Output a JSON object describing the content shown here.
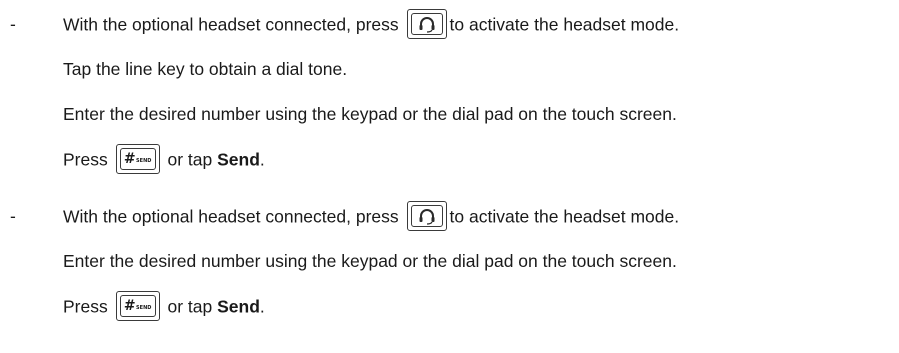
{
  "section1": {
    "bullet": "-",
    "headset_line": {
      "before": "With the optional headset connected, press",
      "after": "to activate the headset mode."
    },
    "line2": "Tap the line key to obtain a dial tone.",
    "line3": "Enter the desired number using the keypad or the dial pad on the touch screen.",
    "press_line": {
      "press": "Press",
      "or_tap": "or tap",
      "send": "Send",
      "period": "."
    }
  },
  "section2": {
    "bullet": "-",
    "headset_line": {
      "before": "With the optional headset connected, press",
      "after": "to activate the headset mode."
    },
    "line2": "Enter the desired number using the keypad or the dial pad on the touch screen.",
    "press_line": {
      "press": "Press",
      "or_tap": "or tap",
      "send": "Send",
      "period": "."
    }
  },
  "keys": {
    "headset_icon": "headset-icon",
    "send_key_label": "#",
    "send_key_sub": "SEND"
  }
}
